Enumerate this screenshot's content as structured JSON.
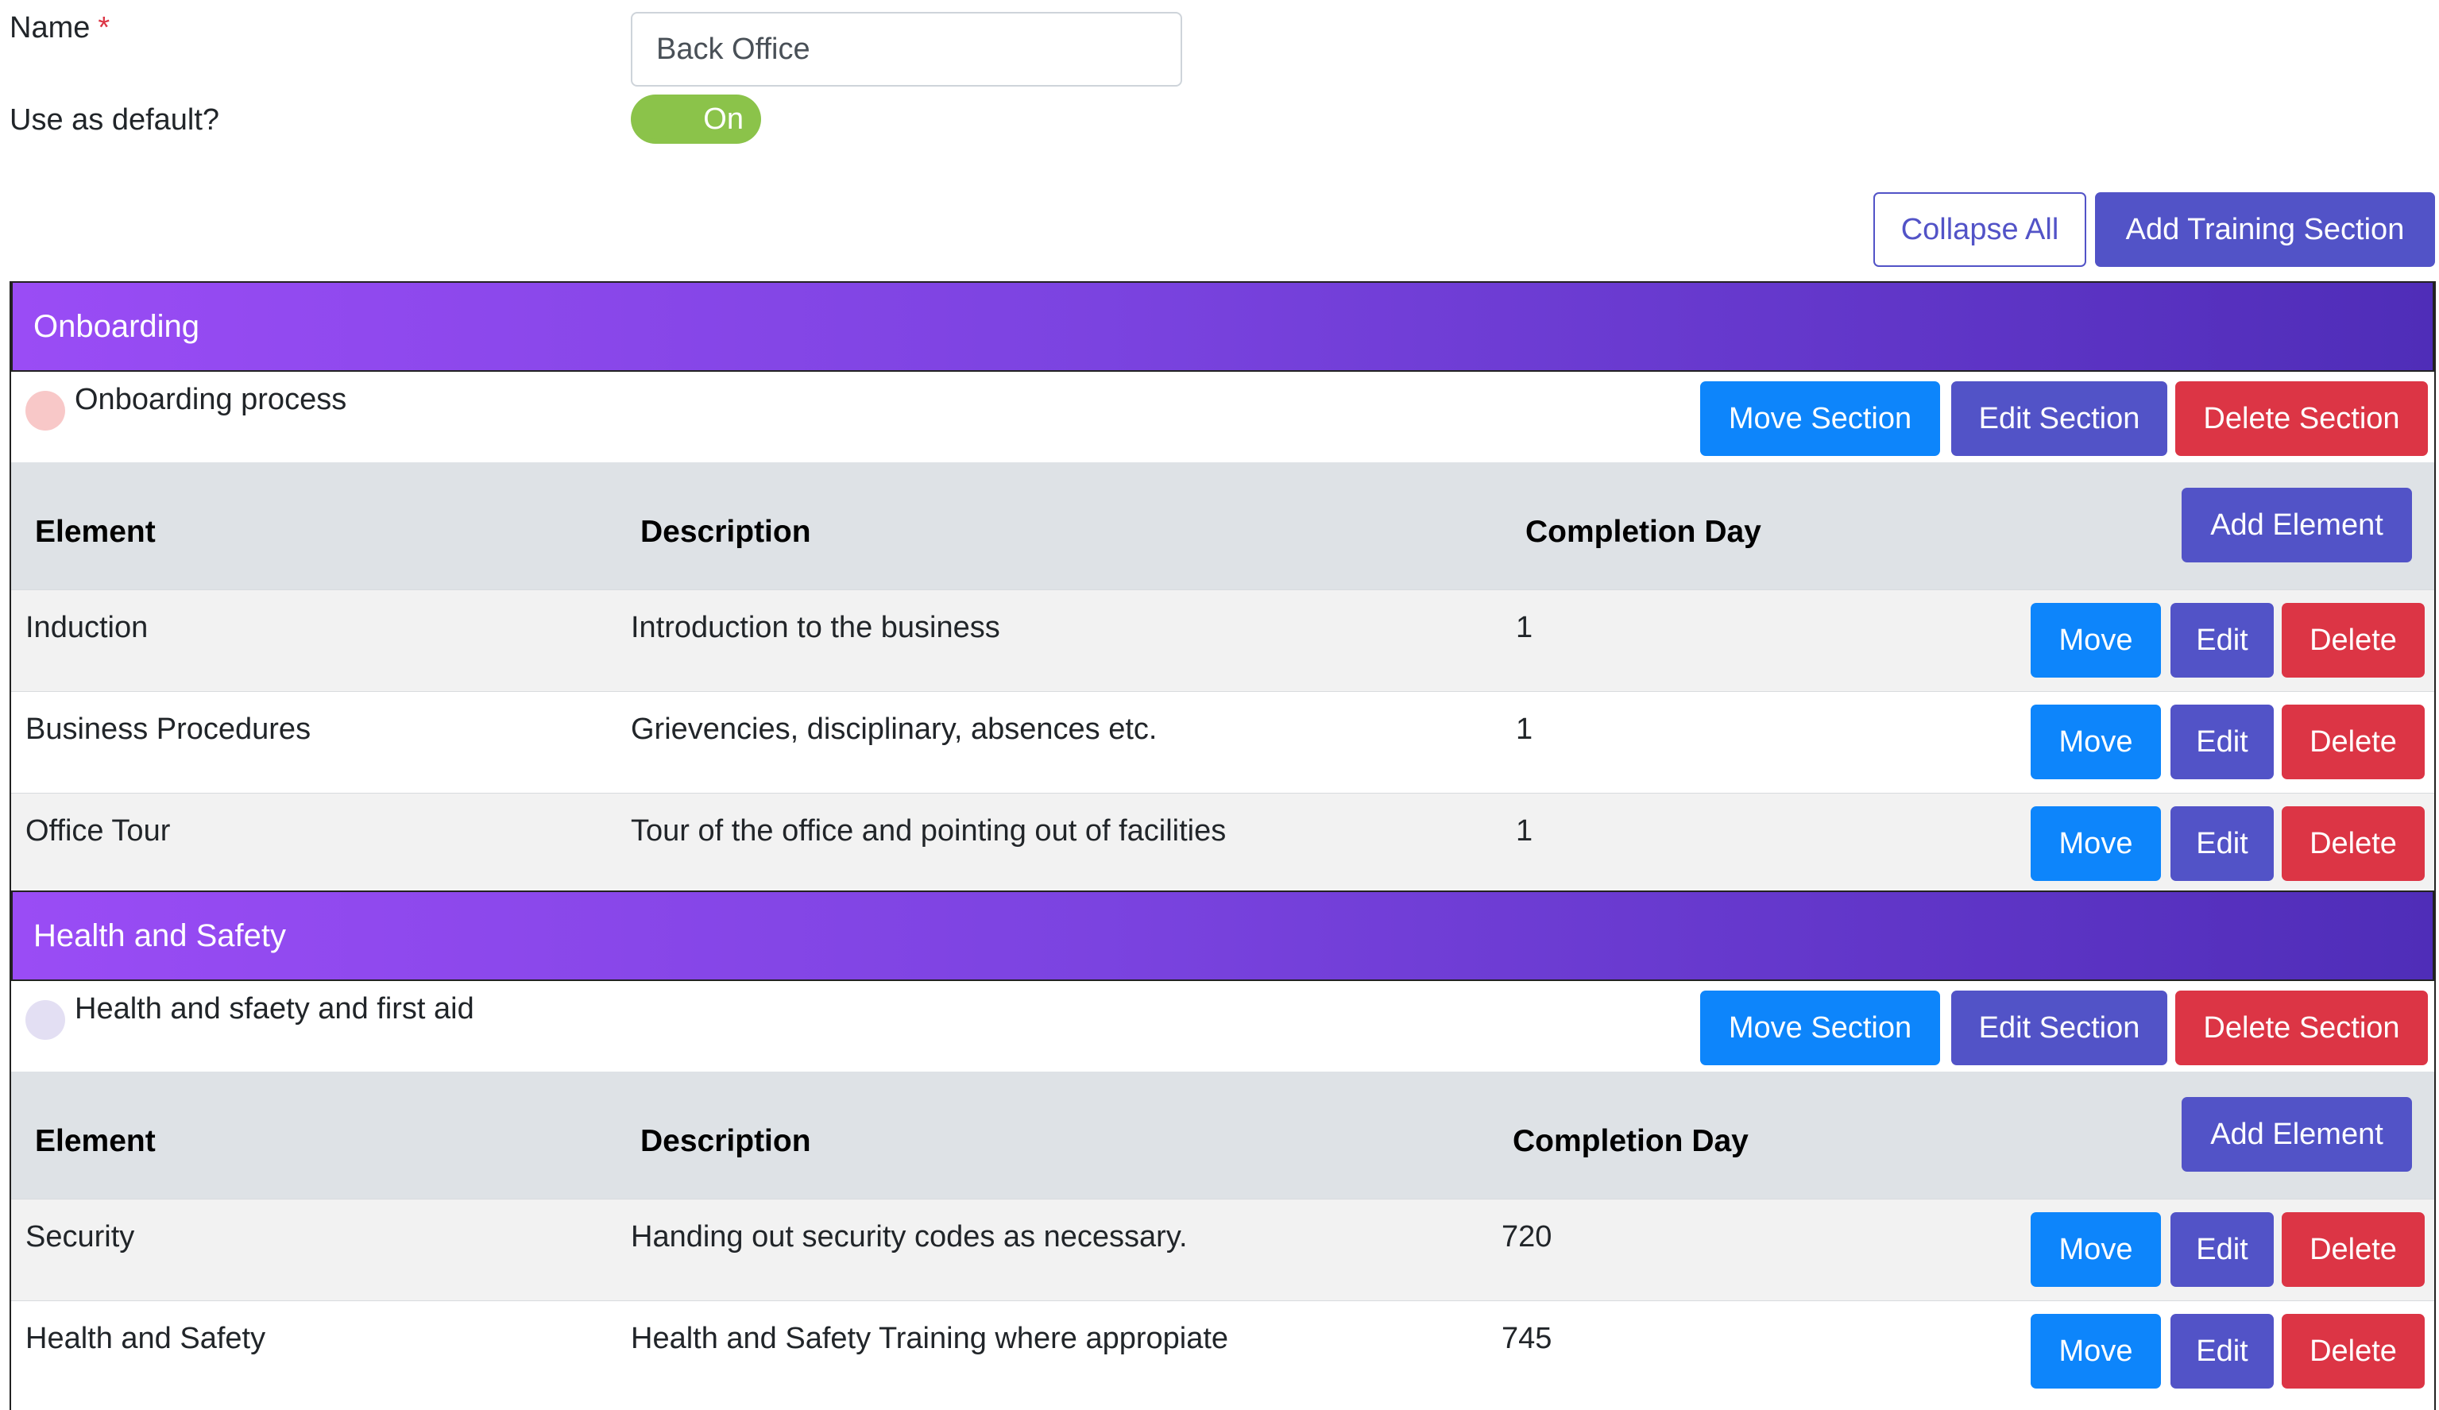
{
  "form": {
    "name_label": "Name",
    "required_marker": "*",
    "name_value": "Back Office",
    "default_label": "Use as default?",
    "default_toggle_text": "On"
  },
  "toolbar": {
    "collapse_all": "Collapse All",
    "add_training_section": "Add Training Section"
  },
  "columns": {
    "element": "Element",
    "description": "Description",
    "completion_day": "Completion Day"
  },
  "section_buttons": {
    "move": "Move Section",
    "edit": "Edit Section",
    "delete": "Delete Section",
    "add_element": "Add Element"
  },
  "row_buttons": {
    "move": "Move",
    "edit": "Edit",
    "delete": "Delete"
  },
  "sections": [
    {
      "header": "Onboarding",
      "title": "Onboarding process",
      "dot_color": "#f8c8c8",
      "rows": [
        {
          "element": "Induction",
          "description": "Introduction to the business",
          "day": "1"
        },
        {
          "element": "Business Procedures",
          "description": "Grievencies, disciplinary, absences etc.",
          "day": "1"
        },
        {
          "element": "Office Tour",
          "description": "Tour of the office and pointing out of facilities",
          "day": "1"
        }
      ]
    },
    {
      "header": "Health and Safety",
      "title": "Health and sfaety and first aid",
      "dot_color": "#e3dff3",
      "rows": [
        {
          "element": "Security",
          "description": "Handing out security codes as necessary.",
          "day": "720"
        },
        {
          "element": "Health and Safety",
          "description": "Health and Safety Training where appropiate",
          "day": "745"
        }
      ]
    }
  ],
  "colors": {
    "primary_blue": "#0d85fb",
    "indigo": "#5253c7",
    "danger": "#dc3545",
    "toggle_on": "#8bc34a",
    "header_gradient_start": "#9a4cf5",
    "header_gradient_end": "#4f2db8"
  }
}
